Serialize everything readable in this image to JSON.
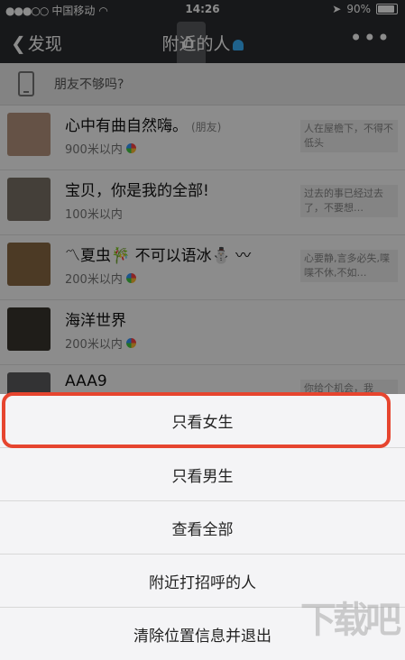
{
  "status_bar": {
    "carrier": "中国移动",
    "time": "14:26",
    "battery": "90%"
  },
  "nav": {
    "back_label": "发现",
    "title": "附近的人"
  },
  "banner": {
    "text": "朋友不够吗?"
  },
  "people": [
    {
      "name": "心中有曲自然嗨。",
      "tag": "(朋友)",
      "distance": "900米以内",
      "signature": "人在屋檐下，不得不低头",
      "avatar_color": "#b99680"
    },
    {
      "name": "宝贝，你是我的全部!",
      "tag": "",
      "distance": "100米以内",
      "signature": "过去的事已经过去了，不要想…",
      "avatar_color": "#7d7468"
    },
    {
      "name": "〽夏虫🎋 不可以语冰⛄ 〰",
      "tag": "",
      "distance": "200米以内",
      "signature": "心要静,言多必失,喋喋不休,不如…",
      "avatar_color": "#8b6a44"
    },
    {
      "name": "海洋世界",
      "tag": "",
      "distance": "200米以内",
      "signature": "",
      "avatar_color": "#3a352f"
    },
    {
      "name": "AAA9",
      "tag": "",
      "distance": "",
      "signature": "你给个机会，我",
      "avatar_color": "#5e5e60"
    }
  ],
  "action_sheet": {
    "options": [
      "只看女生",
      "只看男生",
      "查看全部",
      "附近打招呼的人",
      "清除位置信息并退出"
    ]
  },
  "watermark": "下载吧"
}
